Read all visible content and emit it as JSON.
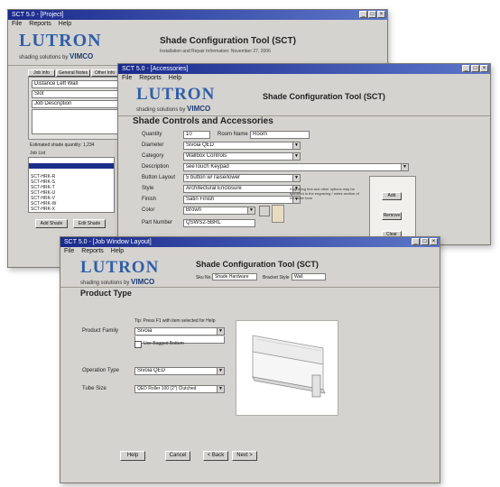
{
  "common": {
    "logo_text": "LUTRON",
    "tagline_prefix": "shading solutions by",
    "tagline_brand": "VIMCO",
    "app_title": "Shade Configuration Tool (SCT)",
    "win_minimize": "_",
    "win_maximize": "□",
    "win_close": "×",
    "dropdown_arrow": "▼"
  },
  "window_back": {
    "title": "SCT 5.0 - [Project]",
    "menu": [
      "File",
      "Reports",
      "Help"
    ],
    "subtitle": "Installation and Repair Information: November 27, 2006",
    "tabs": [
      "Job Info",
      "General Notes",
      "Other Info"
    ],
    "labels": [
      "Distance Left Wall",
      "Slot",
      "Job Description",
      "Estimated shade quantity: 1,234"
    ],
    "list_header": "Job List",
    "rows": [
      "",
      "",
      "",
      "SCT-HRK-R",
      "SCT-HRK-S",
      "SCT-HRK-T",
      "SCT-HRK-U",
      "SCT-HRK-V",
      "SCT-HRK-W",
      "SCT-HRK-X"
    ],
    "selected_row": 1,
    "add_button": "Add Shade",
    "edit_button": "Edit Shade"
  },
  "window_mid": {
    "title": "SCT 5.0 - [Accessories]",
    "menu": [
      "File",
      "Reports",
      "Help"
    ],
    "section": "Shade Controls and Accessories",
    "quantity_label": "Quantity",
    "quantity_value": "10",
    "room_label": "Room Name",
    "room_value": "Room",
    "fields": [
      {
        "label": "Diameter",
        "value": "Sivoia QED"
      },
      {
        "label": "Category",
        "value": "Wallbox Controls"
      },
      {
        "label": "Description",
        "value": "seeTouch Keypad"
      },
      {
        "label": "Button Layout",
        "value": "5 button w/ raise/lower"
      },
      {
        "label": "Style",
        "value": "Architectural Enclosure"
      },
      {
        "label": "Finish",
        "value": "Satin Finish"
      },
      {
        "label": "Color",
        "value": "Brown"
      },
      {
        "label": "Part Number",
        "value": "QSWS2-5BRL"
      }
    ],
    "note": "Engraving text and other options may be specified in the engraving / notes section of the order form",
    "side_buttons": [
      "Add",
      "Remove",
      "Clear"
    ]
  },
  "window_front": {
    "title": "SCT 5.0 - [Job Window Layout]",
    "menu": [
      "File",
      "Reports",
      "Help"
    ],
    "sku_label": "Sku No.",
    "sku_value": "Shade Hardware",
    "bracket_label": "Bracket Style",
    "bracket_value": "Wall",
    "section": "Product Type",
    "family_hint": "Tip: Press F1 with item selected for Help",
    "family_label": "Product Family",
    "family_value": "Sivoia",
    "checkbox_label": "Use Bagged Bottom",
    "system_label": "Operation Type",
    "system_value": "Sivoia QED",
    "tube_label": "Tube Size",
    "tube_value": "QED Roller 100 (2\") Clutched",
    "buttons": [
      "Help",
      "Cancel",
      "< Back",
      "Next >"
    ]
  }
}
